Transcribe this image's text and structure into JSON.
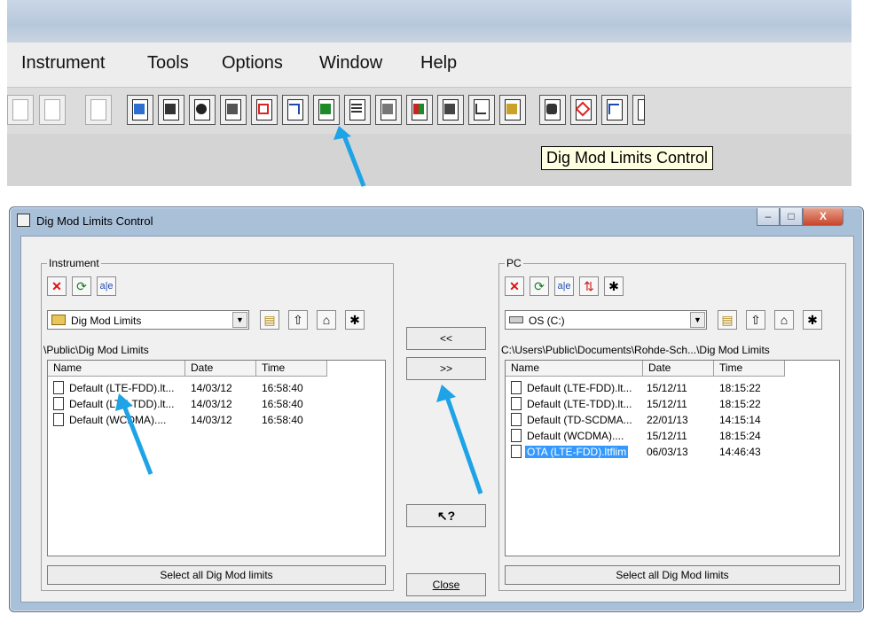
{
  "menubar": {
    "items": [
      "Instrument",
      "Tools",
      "Options",
      "Window",
      "Help"
    ]
  },
  "tooltip": "Dig Mod Limits Control",
  "dialog": {
    "title": "Dig Mod Limits Control",
    "window_buttons": [
      "–",
      "□",
      "X"
    ],
    "instrument": {
      "group_label": "Instrument",
      "folder": "Dig Mod Limits",
      "path": "\\Public\\Dig Mod Limits",
      "columns": [
        "Name",
        "Date",
        "Time"
      ],
      "rows": [
        {
          "name": "Default (LTE-FDD).lt...",
          "date": "14/03/12",
          "time": "16:58:40"
        },
        {
          "name": "Default (LTE-TDD).lt...",
          "date": "14/03/12",
          "time": "16:58:40"
        },
        {
          "name": "Default (WCDMA)....",
          "date": "14/03/12",
          "time": "16:58:40"
        }
      ],
      "select_all": "Select all Dig Mod limits"
    },
    "pc": {
      "group_label": "PC",
      "drive": "OS (C:)",
      "path": "C:\\Users\\Public\\Documents\\Rohde-Sch...\\Dig Mod Limits",
      "columns": [
        "Name",
        "Date",
        "Time"
      ],
      "rows": [
        {
          "name": "Default (LTE-FDD).lt...",
          "date": "15/12/11",
          "time": "18:15:22"
        },
        {
          "name": "Default (LTE-TDD).lt...",
          "date": "15/12/11",
          "time": "18:15:22"
        },
        {
          "name": "Default (TD-SCDMA...",
          "date": "22/01/13",
          "time": "14:15:14"
        },
        {
          "name": "Default (WCDMA)....",
          "date": "15/12/11",
          "time": "18:15:24"
        },
        {
          "name": "OTA (LTE-FDD).ltflim",
          "date": "06/03/13",
          "time": "14:46:43"
        }
      ],
      "select_all": "Select all Dig Mod limits"
    },
    "middle": {
      "copy_to_pc": "<<",
      "copy_to_instrument": ">>",
      "help": "↖?",
      "close": "Close"
    }
  },
  "colors": {
    "arrow": "#1ea3e6",
    "selection": "#3399ff",
    "dialog_frame": "#a9c0d9"
  }
}
